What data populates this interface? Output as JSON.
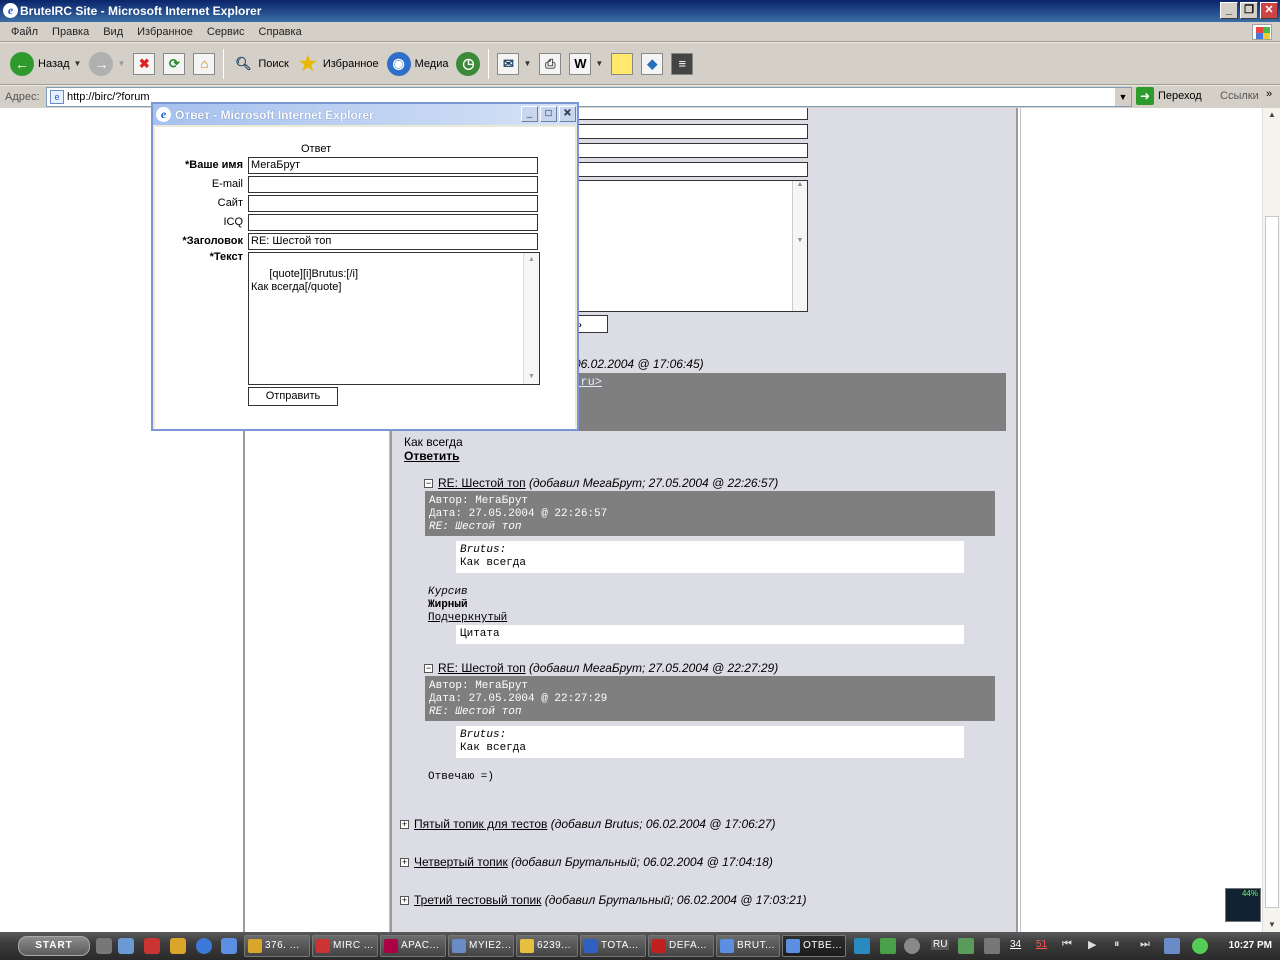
{
  "window": {
    "title": "BruteIRC Site - Microsoft Internet Explorer",
    "controls": [
      "_",
      "❐",
      "✕"
    ]
  },
  "menu": [
    "Файл",
    "Правка",
    "Вид",
    "Избранное",
    "Сервис",
    "Справка"
  ],
  "toolbar": {
    "back": "Назад",
    "search": "Поиск",
    "favorites": "Избранное",
    "media": "Медиа"
  },
  "address": {
    "label": "Адрес:",
    "url": "http://birc/?forum",
    "go": "Переход",
    "links": "Ссылки"
  },
  "background": {
    "post_date": "06.02.2004 @ 17:06:45)",
    "email_fragment": "p.ru>",
    "submit_fragment": "ть",
    "message": "Как всегда",
    "reply": "Ответить",
    "replies": [
      {
        "title": "RE: Шестой топ",
        "meta": "(добавил МегаБрут; 27.05.2004 @ 22:26:57)",
        "author": "Автор: МегаБрут",
        "date": "Дата: 27.05.2004 @ 22:26:57",
        "subject": "RE: Шестой топ",
        "quote_author": "Brutus:",
        "quote_text": "Как всегда"
      },
      {
        "title": "RE: Шестой топ",
        "meta": "(добавил МегаБрут; 27.05.2004 @ 22:27:29)",
        "author": "Автор: МегаБрут",
        "date": "Дата: 27.05.2004 @ 22:27:29",
        "subject": "RE: Шестой топ",
        "quote_author": "Brutus:",
        "quote_text": "Как всегда",
        "body": "Отвечаю =)"
      }
    ],
    "format_sample": {
      "italic": "Курсив",
      "bold": "Жирный",
      "underline": "Подчеркнутый",
      "quote": "Цитата"
    },
    "topics": [
      {
        "title": "Пятый топик для тестов",
        "meta_pre": "(добавил ",
        "author": "Brutus",
        "meta_post": "; 06.02.2004 @ 17:06:27)"
      },
      {
        "title": "Четвертый топик",
        "meta_pre": "(добавил ",
        "author": "Брутальный",
        "meta_post": "; 06.02.2004 @ 17:04:18)"
      },
      {
        "title": "Третий тестовый топик",
        "meta_pre": "(добавил ",
        "author": "Брутальный",
        "meta_post": "; 06.02.2004 @ 17:03:21)"
      }
    ]
  },
  "popup": {
    "title": "Ответ - Microsoft Internet Explorer",
    "caption": "Ответ",
    "fields": {
      "name_label": "*Ваше имя",
      "name_value": "МегаБрут",
      "email_label": "E-mail",
      "email_value": "",
      "site_label": "Сайт",
      "site_value": "",
      "icq_label": "ICQ",
      "icq_value": "",
      "subject_label": "*Заголовок",
      "subject_value": "RE: Шестой топ",
      "text_label": "*Текст",
      "text_value": "[quote][i]Brutus:[/i]\nКак всегда[/quote]"
    },
    "submit": "Отправить"
  },
  "taskbar": {
    "start": "START",
    "tasks": [
      "376. ...",
      "MIRC ...",
      "APAC...",
      "MYIE2...",
      "6239...",
      "TOTA...",
      "DEFA...",
      "BRUT...",
      "ОТВЕ..."
    ],
    "tray_lang": "RU",
    "tray_nums": [
      "34",
      "51"
    ],
    "cpu": "44%",
    "clock": "10:27 PM"
  }
}
